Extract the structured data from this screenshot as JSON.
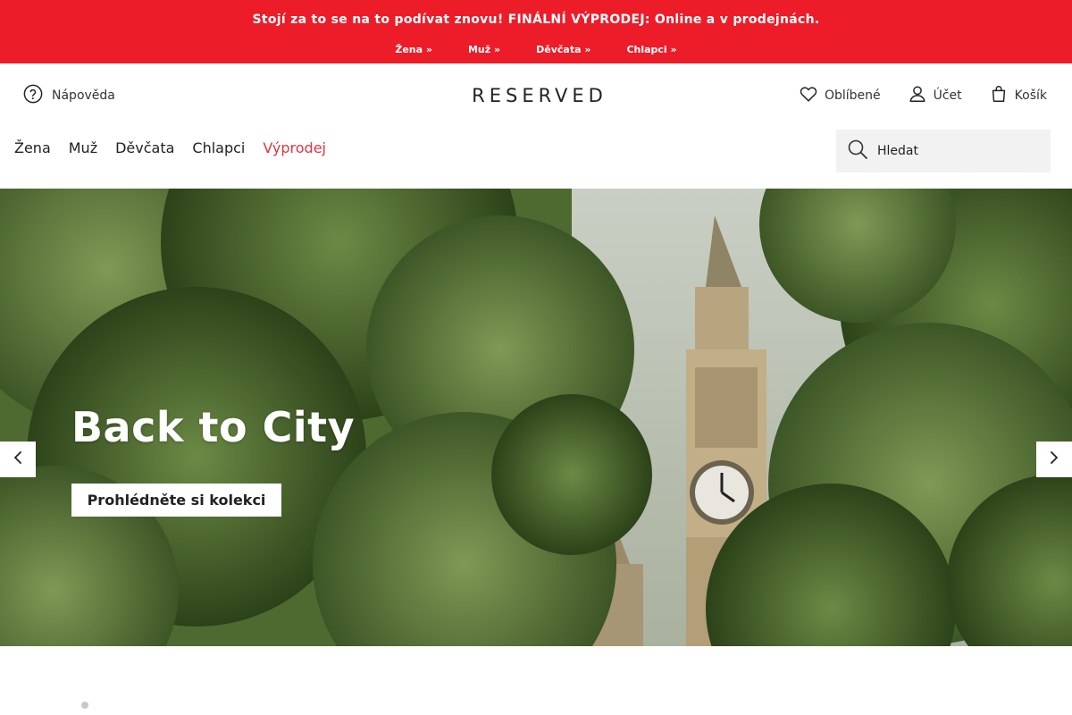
{
  "promo": {
    "message": "Stojí za to se na to podívat znovu! FINÁLNÍ VÝPRODEJ: Online a v prodejnách.",
    "links": [
      "Žena »",
      "Muž »",
      "Děvčata »",
      "Chlapci »"
    ],
    "background_color": "#ec1c28"
  },
  "header": {
    "help_label": "Nápověda",
    "logo": "RESERVED",
    "favorites_label": "Oblíbené",
    "account_label": "Účet",
    "cart_label": "Košík"
  },
  "nav": {
    "items": [
      "Žena",
      "Muž",
      "Děvčata",
      "Chlapci",
      "Výprodej"
    ],
    "sale_color": "#e0353f"
  },
  "search": {
    "placeholder": "Hledat"
  },
  "hero": {
    "title": "Back to City",
    "cta_label": "Prohlédněte si kolekci",
    "icons": {
      "prev": "chevron-left-icon",
      "next": "chevron-right-icon"
    }
  }
}
